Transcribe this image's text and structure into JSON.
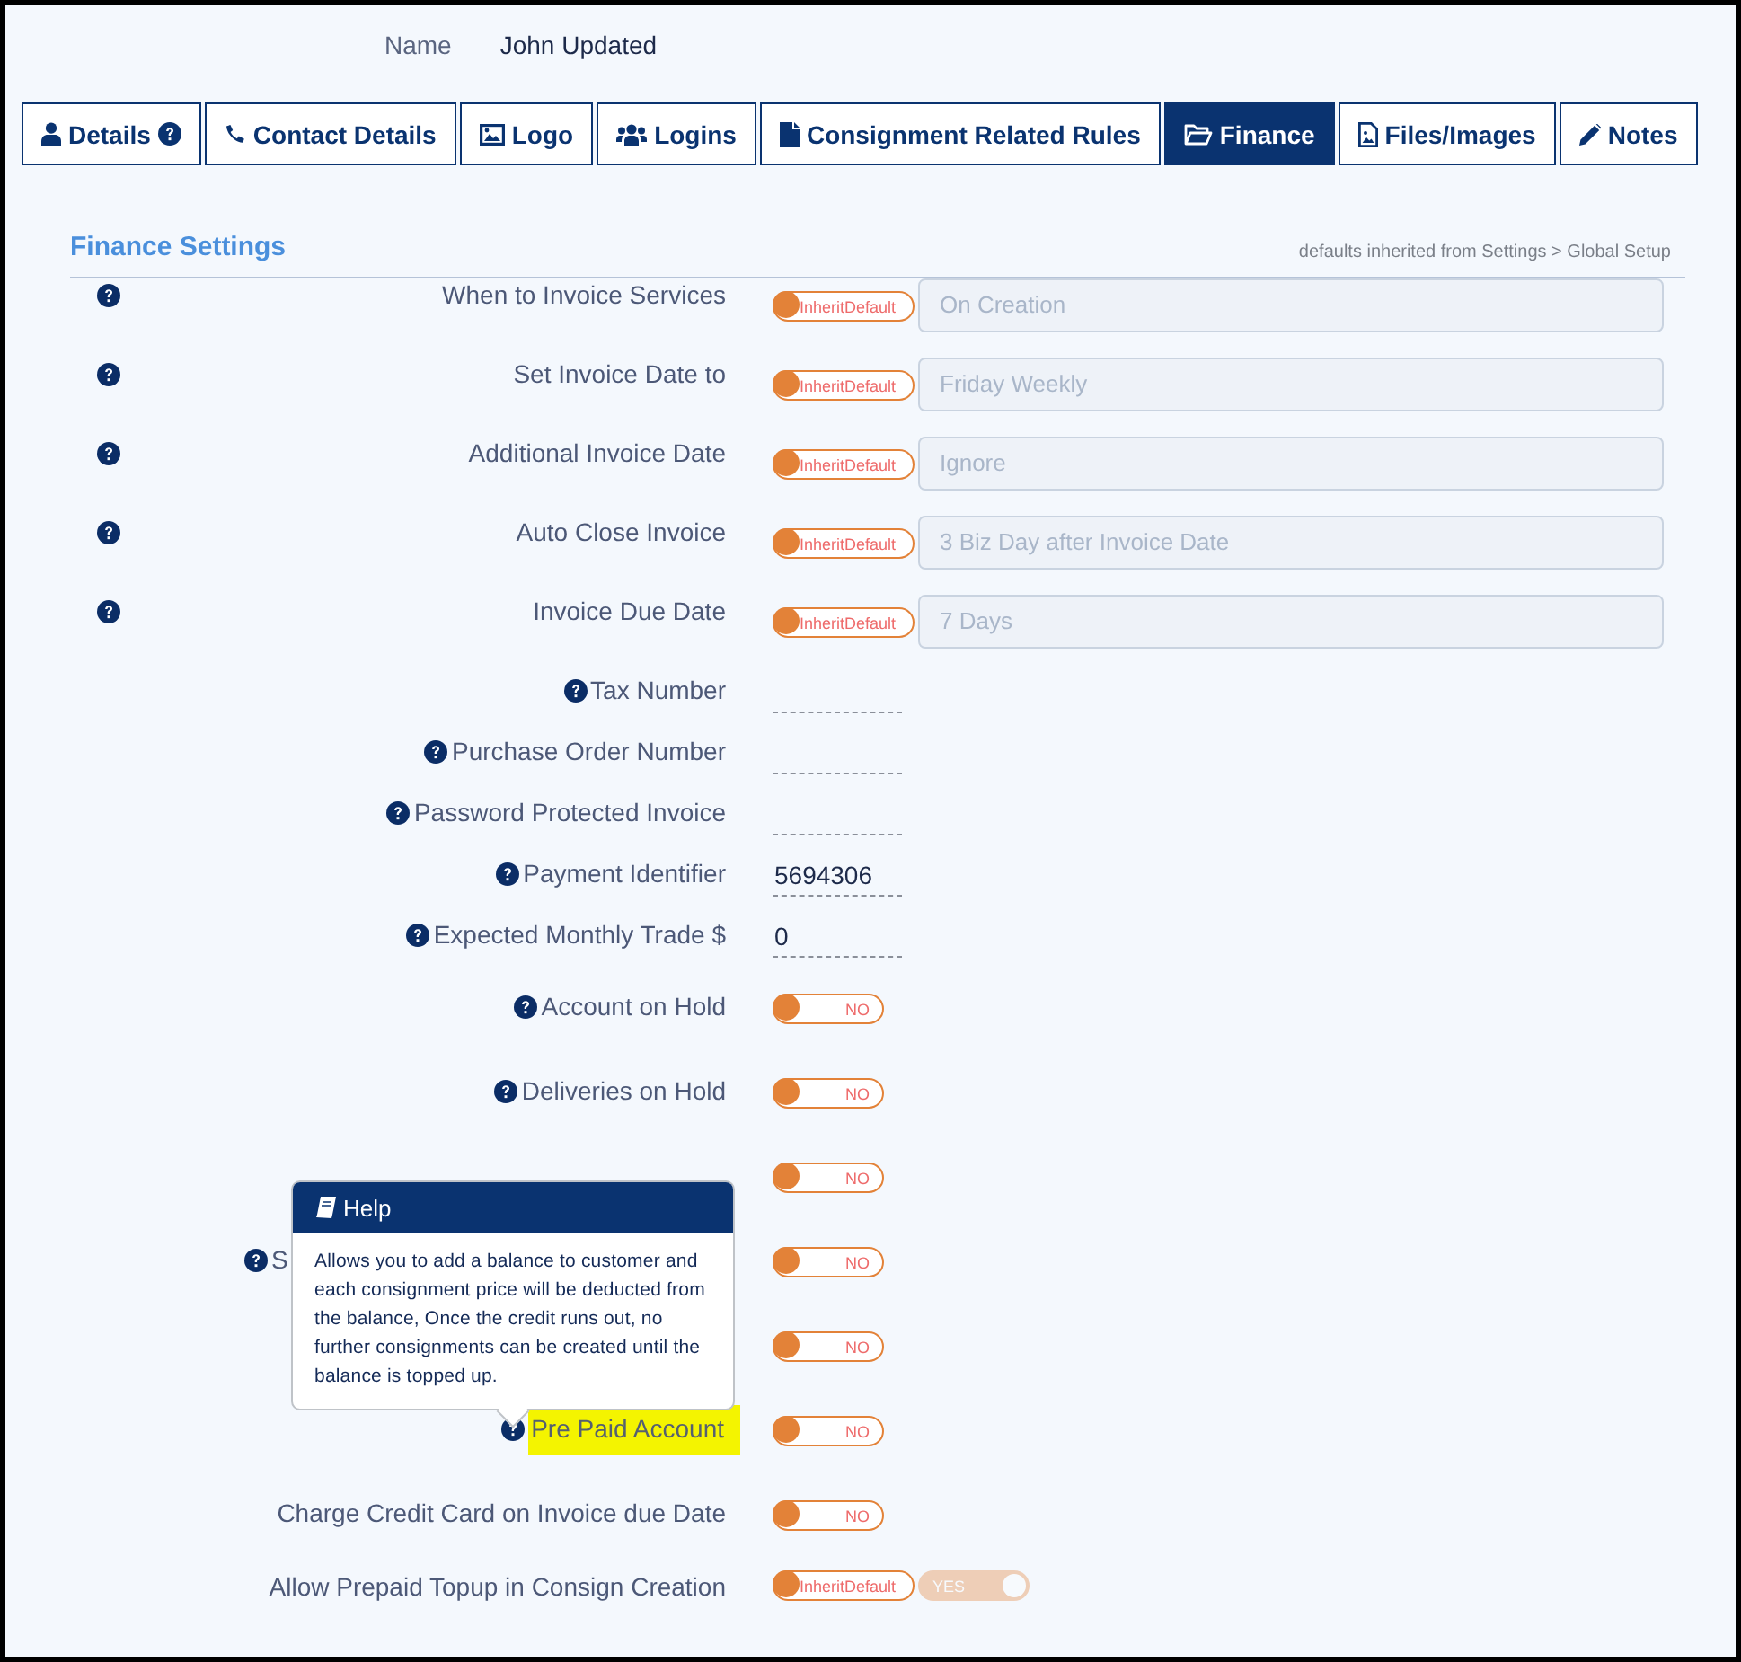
{
  "header": {
    "name_label": "Name",
    "name_value": "John Updated"
  },
  "tabs": [
    {
      "label": "Details",
      "selected": false
    },
    {
      "label": "Contact Details",
      "selected": false
    },
    {
      "label": "Logo",
      "selected": false
    },
    {
      "label": "Logins",
      "selected": false
    },
    {
      "label": "Consignment Related Rules",
      "selected": false
    },
    {
      "label": "Finance",
      "selected": true
    },
    {
      "label": "Files/Images",
      "selected": false
    },
    {
      "label": "Notes",
      "selected": false
    }
  ],
  "section": {
    "title": "Finance Settings",
    "note": "defaults inherited from Settings > Global Setup"
  },
  "settings": [
    {
      "kind": "select",
      "help": true,
      "label": "When to Invoice Services",
      "inherit_text": "InheritDefault",
      "value": "On Creation"
    },
    {
      "kind": "select",
      "help": true,
      "label": "Set Invoice Date to",
      "inherit_text": "InheritDefault",
      "value": "Friday Weekly"
    },
    {
      "kind": "select",
      "help": true,
      "label": "Additional Invoice Date",
      "inherit_text": "InheritDefault",
      "value": "Ignore"
    },
    {
      "kind": "select",
      "help": true,
      "label": "Auto Close Invoice",
      "inherit_text": "InheritDefault",
      "value": "3 Biz Day after Invoice Date"
    },
    {
      "kind": "select",
      "help": true,
      "label": "Invoice Due Date",
      "inherit_text": "InheritDefault",
      "value": "7 Days"
    },
    {
      "kind": "text",
      "help": true,
      "label": "Tax Number"
    },
    {
      "kind": "text",
      "help": true,
      "label": "Purchase Order Number"
    },
    {
      "kind": "text",
      "help": true,
      "label": "Password Protected Invoice"
    },
    {
      "kind": "text",
      "help": true,
      "label": "Payment Identifier",
      "value": "5694306"
    },
    {
      "kind": "text",
      "help": true,
      "label": "Expected Monthly Trade $",
      "value": "0"
    },
    {
      "kind": "switch",
      "help": true,
      "label": "Account on Hold",
      "on": false,
      "toggle_text": "NO"
    },
    {
      "kind": "switch",
      "help": true,
      "label": "Deliveries on Hold",
      "on": false,
      "toggle_text": "NO"
    },
    {
      "kind": "switch",
      "help": false,
      "on": false,
      "toggle_text": "NO"
    },
    {
      "kind": "switch",
      "help": true,
      "label": "S",
      "on": false,
      "toggle_text": "NO"
    },
    {
      "kind": "switch",
      "help": false,
      "on": false,
      "toggle_text": "NO"
    },
    {
      "kind": "switch",
      "help": true,
      "label": "Pre Paid Account",
      "on": false,
      "toggle_text": "NO",
      "highlighted": true
    },
    {
      "kind": "switch",
      "help": false,
      "label": "Charge Credit Card on Invoice due Date",
      "on": false,
      "toggle_text": "NO"
    },
    {
      "kind": "inherit_switch",
      "help": false,
      "label": "Allow Prepaid Topup in Consign Creation",
      "inherit_text": "InheritDefault",
      "on": true,
      "toggle_text": "YES",
      "disabled": true
    }
  ],
  "tooltip": {
    "title": "Help",
    "text": "Allows you to add a balance to customer and each consignment price will be deducted from the balance, Once the credit runs out, no further consignments can be created until the balance is topped up."
  }
}
